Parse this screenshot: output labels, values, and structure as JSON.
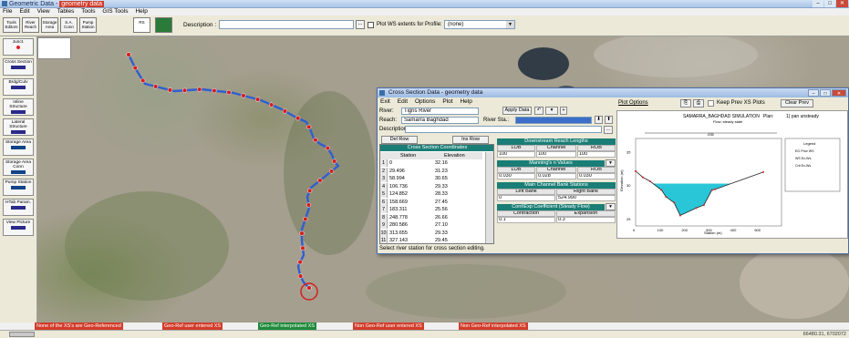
{
  "window": {
    "title": "Geometric Data",
    "title_sub": "geometry data",
    "min": "–",
    "max": "□",
    "close": "✕"
  },
  "menu": [
    "File",
    "Edit",
    "View",
    "Tables",
    "Tools",
    "GIS Tools",
    "Help"
  ],
  "toolbar": {
    "buttons": [
      {
        "label": "Tools Editors"
      },
      {
        "label": "River Reach"
      },
      {
        "label": "Storage Area"
      },
      {
        "label": "S.A. Conn"
      },
      {
        "label": "Pump Station"
      },
      {
        "label": "RS"
      },
      {
        "label": ""
      }
    ],
    "description_label": "Description :",
    "description_value": "",
    "plot_ws_label": "Plot WS extents for Profile:",
    "profile_value": "(none)"
  },
  "left_tools": [
    "Junct.",
    "Cross Section",
    "Brdg/Culv",
    "Inline Structure",
    "Lateral Structure",
    "Storage Area",
    "Storage Area Conn",
    "Pump Station",
    "HTab Param.",
    "View Picture"
  ],
  "legend_items": [
    {
      "text": "None of the XS's are Geo-Referenced",
      "color": "#d23c2a"
    },
    {
      "text": "Geo-Ref user entered XS",
      "color": "#d23c2a"
    },
    {
      "text": "Geo-Ref interpolated XS",
      "color": "#1e8a3a"
    },
    {
      "text": "Non Geo-Ref user entered XS",
      "color": "#d23c2a"
    },
    {
      "text": "Non Geo-Ref interpolated XS",
      "color": "#d23c2a"
    }
  ],
  "coords": "66480.31, 6702072",
  "xs_dialog": {
    "title": "Cross Section Data - geometry data",
    "menu": [
      "Exit",
      "Edit",
      "Options",
      "Plot",
      "Help"
    ],
    "river_label": "River:",
    "river_value": "Tigris River",
    "reach_label": "Reach:",
    "reach_value": "Samarra Baghdad",
    "river_sta_label": "River Sta.:",
    "river_sta_value": "",
    "apply_label": "Apply Data",
    "description_label": "Description",
    "del_row": "Del Row",
    "ins_row": "Ins Row",
    "coords_header": "Cross Section Coordinates",
    "col_station": "Station",
    "col_elevation": "Elevation",
    "rows": [
      {
        "n": "1",
        "station": "0",
        "elev": "32.16"
      },
      {
        "n": "2",
        "station": "29.496",
        "elev": "31.23"
      },
      {
        "n": "3",
        "station": "58.994",
        "elev": "30.65"
      },
      {
        "n": "4",
        "station": "106.736",
        "elev": "29.33"
      },
      {
        "n": "5",
        "station": "124.852",
        "elev": "28.33"
      },
      {
        "n": "6",
        "station": "158.669",
        "elev": "27.45"
      },
      {
        "n": "7",
        "station": "183.311",
        "elev": "25.56"
      },
      {
        "n": "8",
        "station": "248.778",
        "elev": "26.66"
      },
      {
        "n": "9",
        "station": "280.586",
        "elev": "27.10"
      },
      {
        "n": "10",
        "station": "313.655",
        "elev": "29.33"
      },
      {
        "n": "11",
        "station": "327.143",
        "elev": "29.45"
      }
    ],
    "downstream_header": "Downstream Reach Lengths",
    "ds_cols": [
      "LOB",
      "Channel",
      "ROB"
    ],
    "ds_vals": [
      "100",
      "100",
      "100"
    ],
    "manning_header": "Manning's n Values",
    "mn_cols": [
      "LOB",
      "Channel",
      "ROB"
    ],
    "mn_vals": [
      "0.030",
      "0.028",
      "0.030"
    ],
    "bank_header": "Main Channel Bank Stations",
    "bank_cols": [
      "Left Bank",
      "Right Bank"
    ],
    "bank_vals": [
      "0",
      "524.990"
    ],
    "coef_header": "Cont\\Exp Coefficient (Steady Flow)",
    "coef_cols": [
      "Contraction",
      "Expansion"
    ],
    "coef_vals": [
      "0.1",
      "0.3"
    ],
    "status": "Select river station for cross section editing.",
    "plot_options": "Plot Options",
    "keep_prev": "Keep Prev XS Plots",
    "clear_prev": "Clear Prev",
    "plot_title": "SAMARRA_BAGHDAD SIMULATION",
    "plot_plan": "Plan:",
    "plot_plan_val": "1) pan unsteady",
    "plot_flow": "Flow: steady state",
    "plot_xlabel": "Station (m)",
    "plot_ylabel": "Elevation (m)",
    "plot_scale": ".035",
    "legend_title": "Legend",
    "legend_items": [
      "EG Prior WS",
      "WS Ex-Ws",
      "Crit Ex-Ws"
    ],
    "y_ticks": [
      "35",
      "30",
      "25"
    ],
    "x_ticks": [
      "0",
      "100",
      "200",
      "300",
      "400",
      "500"
    ]
  },
  "chart_data": {
    "type": "area",
    "title": "SAMARRA_BAGHDAD SIMULATION",
    "xlabel": "Station (m)",
    "ylabel": "Elevation (m)",
    "x": [
      0,
      29.496,
      58.994,
      106.736,
      124.852,
      158.669,
      183.311,
      248.778,
      280.586,
      313.655,
      327.143,
      524.99
    ],
    "y": [
      32.16,
      31.23,
      30.65,
      29.33,
      28.33,
      27.45,
      25.56,
      26.66,
      27.1,
      29.33,
      29.45,
      32.0
    ],
    "water_surface": 30.3,
    "xlim": [
      0,
      600
    ],
    "ylim": [
      24,
      37
    ],
    "legend": "right"
  },
  "colors": {
    "river": "#2f5fd0",
    "xs_marker": "#d22020",
    "teal_header": "#1a7e76",
    "water_fill": "#29c6d8"
  }
}
